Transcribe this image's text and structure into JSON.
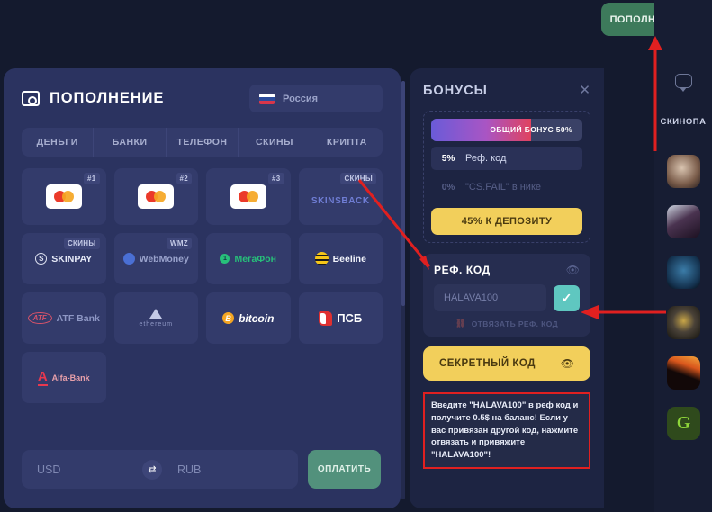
{
  "topbar": {
    "deposit_button": "ПОПОЛНЕНИЕ",
    "deposit_icon": "wallet-icon"
  },
  "modal": {
    "title": "ПОПОЛНЕНИЕ",
    "title_icon": "wallet-icon",
    "country": {
      "name": "Россия",
      "flag": "russia-flag",
      "caret": "chevron-down-icon"
    },
    "tabs": [
      {
        "label": "ДЕНЬГИ"
      },
      {
        "label": "БАНКИ"
      },
      {
        "label": "ТЕЛЕФОН"
      },
      {
        "label": "СКИНЫ"
      },
      {
        "label": "КРИПТА"
      }
    ],
    "methods": [
      {
        "name": "Mastercard",
        "badge": "#1",
        "kind": "mastercard"
      },
      {
        "name": "Mastercard",
        "badge": "#2",
        "kind": "mastercard"
      },
      {
        "name": "Mastercard",
        "badge": "#3",
        "kind": "mastercard"
      },
      {
        "name": "SKINSBACK",
        "badge": "СКИНЫ",
        "kind": "skinsback"
      },
      {
        "name": "SKINPAY",
        "badge": "СКИНЫ",
        "kind": "skinpay"
      },
      {
        "name": "WebMoney",
        "badge": "WMZ",
        "kind": "webmoney"
      },
      {
        "name": "МегаФон",
        "badge": "",
        "kind": "megafon"
      },
      {
        "name": "Beeline",
        "badge": "",
        "kind": "beeline"
      },
      {
        "name": "ATF Bank",
        "badge": "",
        "kind": "atfbank"
      },
      {
        "name": "ethereum",
        "badge": "",
        "kind": "ethereum"
      },
      {
        "name": "bitcoin",
        "badge": "",
        "kind": "bitcoin"
      },
      {
        "name": "ПСБ",
        "badge": "",
        "kind": "psb"
      },
      {
        "name": "Alfa-Bank",
        "badge": "",
        "kind": "alfabank"
      }
    ],
    "amount": {
      "from_placeholder": "USD",
      "to_placeholder": "RUB",
      "swap_icon": "swap-arrows-icon",
      "pay_button": "ОПЛАТИТЬ"
    }
  },
  "bonuses": {
    "title": "БОНУСЫ",
    "close_icon": "close-icon",
    "progress": {
      "label": "ОБЩИЙ БОНУС 50%",
      "percent": 66
    },
    "rows": [
      {
        "percent": "5%",
        "label": "Реф. код",
        "state": "active"
      },
      {
        "percent": "0%",
        "label": "\"CS.FAIL\" в нике",
        "state": "dim"
      }
    ],
    "deposit_bonus_button": "45% К ДЕПОЗИТУ",
    "ref": {
      "title": "РЕФ. КОД",
      "eye_icon": "eye-off-icon",
      "input_value": "HALAVA100",
      "confirm_icon": "check-icon",
      "unlink_label": "ОТВЯЗАТЬ РЕФ. КОД",
      "unlink_icon": "unlink-icon"
    },
    "secret": {
      "label": "СЕКРЕТНЫЙ КОД",
      "eye_icon": "eye-icon"
    },
    "note": "Введите \"HALAVA100\" в реф код и получите 0.5$ на баланс! Если у вас привязан другой код, нажмите отвязать и привяжите \"HALAVA100\"!"
  },
  "rail": {
    "chat_icon": "chat-bubble-icon",
    "label": "СКИНОПА",
    "thumbnails": [
      {
        "name": "avatar-1"
      },
      {
        "name": "avatar-2"
      },
      {
        "name": "avatar-3"
      },
      {
        "name": "avatar-4"
      },
      {
        "name": "avatar-5"
      },
      {
        "name": "avatar-6"
      }
    ]
  },
  "annotations": {
    "arrow_color": "#e02020"
  }
}
